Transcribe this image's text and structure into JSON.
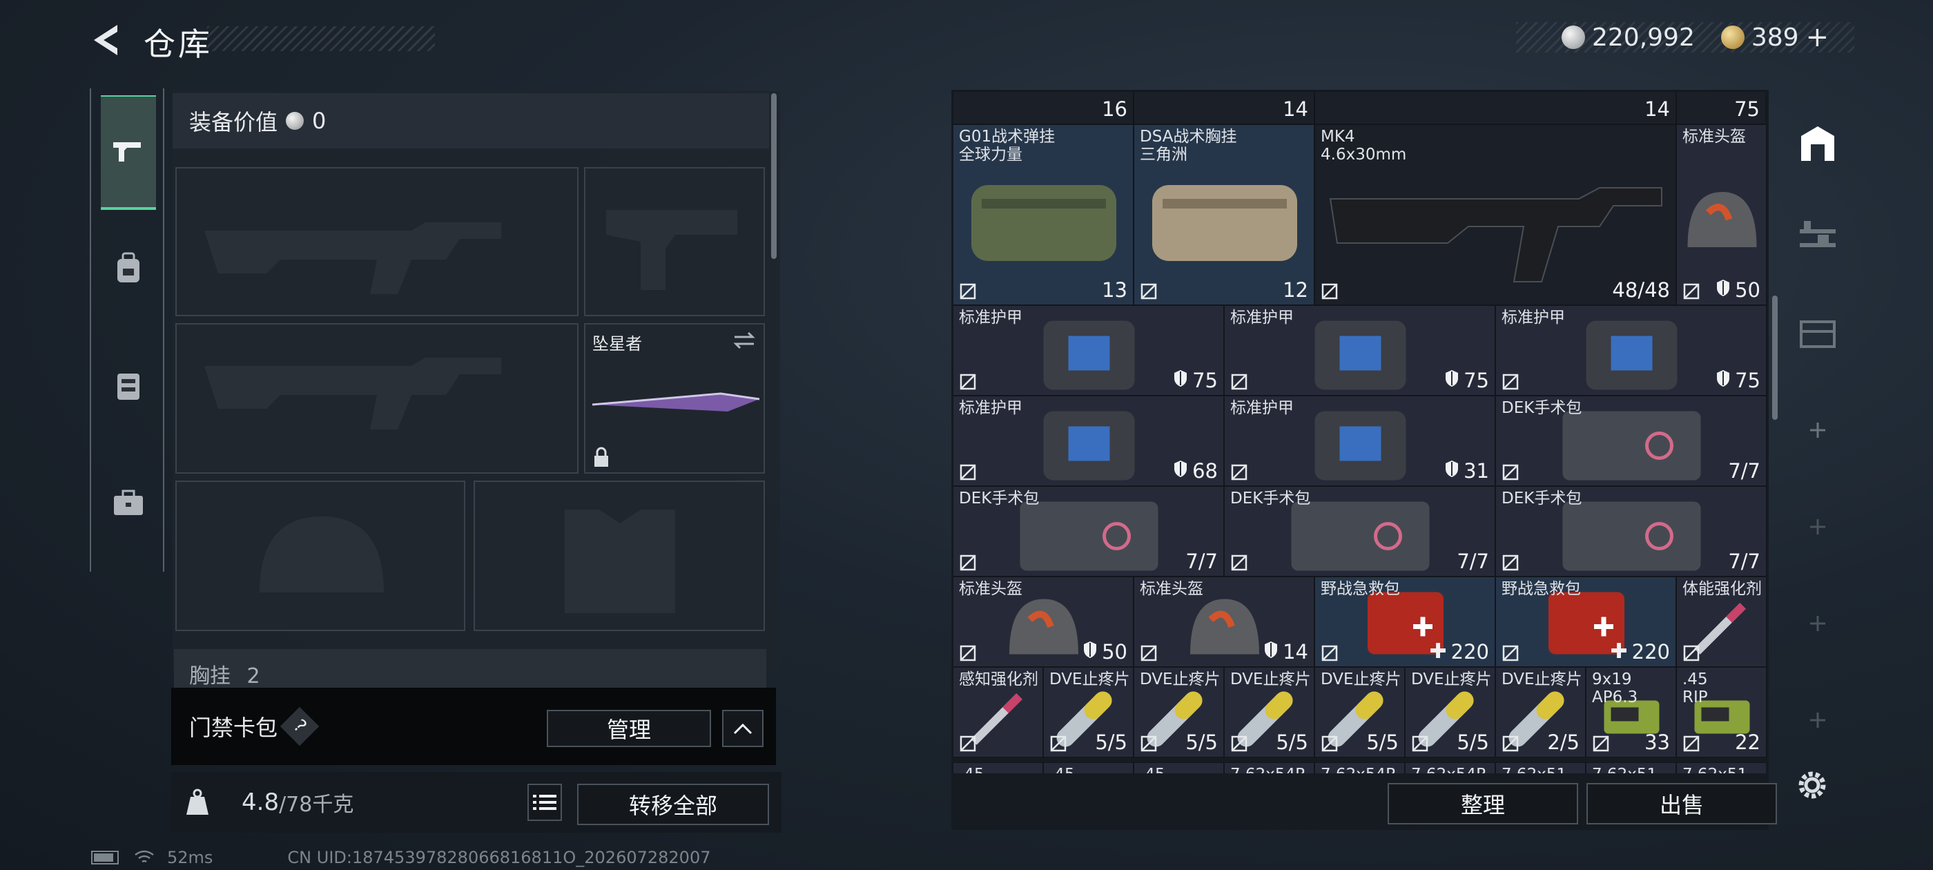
{
  "header": {
    "title": "仓库"
  },
  "currency": {
    "silver": "220,992",
    "gold": "389",
    "add_label": "+"
  },
  "equipment": {
    "value_label": "装备价值",
    "value": "0",
    "slot_melee_name": "坠星者",
    "chest_label": "胸挂",
    "chest_count": "2"
  },
  "card_pack": {
    "label": "门禁卡包",
    "help": "?",
    "manage_label": "管理"
  },
  "weight": {
    "current": "4.8",
    "limit": "/78千克",
    "transfer_all_label": "转移全部"
  },
  "warehouse": {
    "top_counts": {
      "a": "16",
      "b": "14",
      "c": "14",
      "d": "75"
    },
    "items": [
      {
        "name": "G01战术弹挂\n全球力量",
        "value": "13"
      },
      {
        "name": "DSA战术胸挂\n三角洲",
        "value": "12"
      },
      {
        "name": "MK4\n4.6x30mm",
        "value": "48/48"
      },
      {
        "name": "标准头盔",
        "value": "50"
      },
      {
        "name": "标准护甲",
        "value": "75"
      },
      {
        "name": "标准护甲",
        "value": "75"
      },
      {
        "name": "标准护甲",
        "value": "75"
      },
      {
        "name": "标准护甲",
        "value": "68"
      },
      {
        "name": "标准护甲",
        "value": "31"
      },
      {
        "name": "DEK手术包",
        "value": "7/7"
      },
      {
        "name": "DEK手术包",
        "value": "7/7"
      },
      {
        "name": "DEK手术包",
        "value": "7/7"
      },
      {
        "name": "DEK手术包",
        "value": "7/7"
      },
      {
        "name": "标准头盔",
        "value": "50"
      },
      {
        "name": "标准头盔",
        "value": "14"
      },
      {
        "name": "野战急救包",
        "value": "220"
      },
      {
        "name": "野战急救包",
        "value": "220"
      },
      {
        "name": "体能强化剂",
        "value": ""
      },
      {
        "name": "感知强化剂",
        "value": ""
      },
      {
        "name": "DVE止疼片",
        "value": "5/5"
      },
      {
        "name": "DVE止疼片",
        "value": "5/5"
      },
      {
        "name": "DVE止疼片",
        "value": "5/5"
      },
      {
        "name": "DVE止疼片",
        "value": "5/5"
      },
      {
        "name": "DVE止疼片",
        "value": "5/5"
      },
      {
        "name": "DVE止疼片",
        "value": "2/5"
      },
      {
        "name": "9x19\nAP6.3",
        "value": "33"
      },
      {
        "name": ".45\nRIP",
        "value": "22"
      }
    ],
    "partial_row": [
      ".45",
      ".45",
      ".45",
      "7.62x54R",
      "7.62x54R",
      "7.62x54R",
      "7.62x51",
      "7.62x51",
      "7.62x51"
    ],
    "sort_label": "整理",
    "sell_label": "出售"
  },
  "status": {
    "ping": "52ms",
    "uid": "CN UID:18745397828066816811O_202607282007"
  }
}
